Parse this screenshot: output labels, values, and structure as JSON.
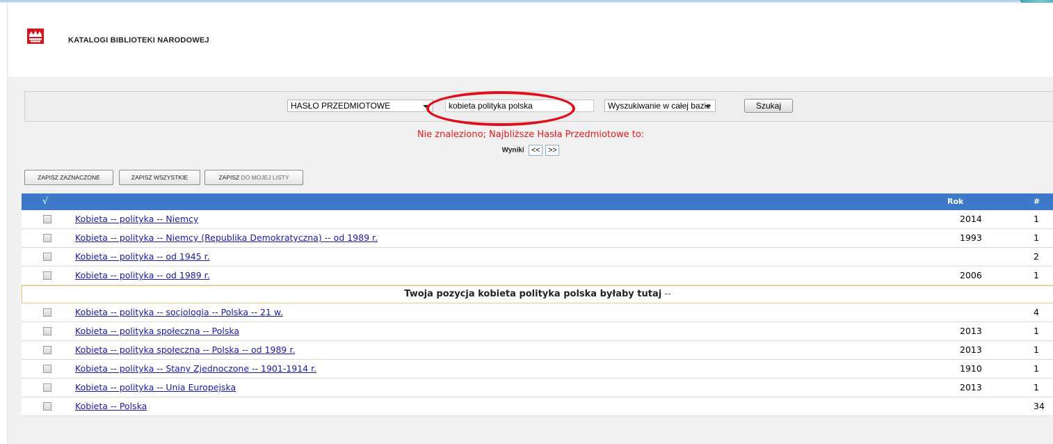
{
  "header": {
    "site_title": "KATALOGI BIBLIOTEKI NARODOWEJ"
  },
  "search": {
    "field_select": "HASŁO PRZEDMIOTOWE",
    "query": "kobieta polityka polska",
    "scope_select": "Wyszukiwanie w całej bazie",
    "button": "Szukaj"
  },
  "message": "Nie znaleziono; Najbliższe Hasła Przedmiotowe to:",
  "results_nav": {
    "label": "Wyniki",
    "prev": "<<",
    "next": ">>"
  },
  "actions": {
    "save_selected": "ZAPISZ ZAZNACZONE",
    "save_all": "ZAPISZ WSZYSTKIE",
    "save_list_bold": "ZAPISZ",
    "save_list_rest": "DO MOJEJ LISTY"
  },
  "table": {
    "header": {
      "check": "√",
      "year": "Rok",
      "count": "#"
    },
    "rows_before": [
      {
        "title": "Kobieta -- polityka -- Niemcy",
        "year": "2014",
        "count": "1"
      },
      {
        "title": "Kobieta -- polityka -- Niemcy (Republika Demokratyczna) -- od 1989 r.",
        "year": "1993",
        "count": "1"
      },
      {
        "title": "Kobieta -- polityka -- od 1945 r.",
        "year": "",
        "count": "2"
      },
      {
        "title": "Kobieta -- polityka -- od 1989 r.",
        "year": "2006",
        "count": "1"
      }
    ],
    "position_row": {
      "text": "Twoja pozycja kobieta polityka polska byłaby tutaj",
      "separator": "--"
    },
    "rows_after": [
      {
        "title": "Kobieta -- polityka -- socjologia -- Polska -- 21 w.",
        "year": "",
        "count": "4"
      },
      {
        "title": "Kobieta -- polityka społeczna -- Polska",
        "year": "2013",
        "count": "1"
      },
      {
        "title": "Kobieta -- polityka społeczna -- Polska -- od 1989 r.",
        "year": "2013",
        "count": "1"
      },
      {
        "title": "Kobieta -- polityka -- Stany Zjednoczone -- 1901-1914 r.",
        "year": "1910",
        "count": "1"
      },
      {
        "title": "Kobieta -- polityka -- Unia Europejska",
        "year": "2013",
        "count": "1"
      },
      {
        "title": "Kobieta -- Polska",
        "year": "",
        "count": "34"
      }
    ]
  },
  "colors": {
    "header_bar": "#3d79c8",
    "message": "#e8181c",
    "link": "#1a1aa6",
    "annotation": "#e0101a"
  },
  "icons": {
    "logo": "library-crown-logo",
    "dropdown": "chevron-down-icon"
  }
}
